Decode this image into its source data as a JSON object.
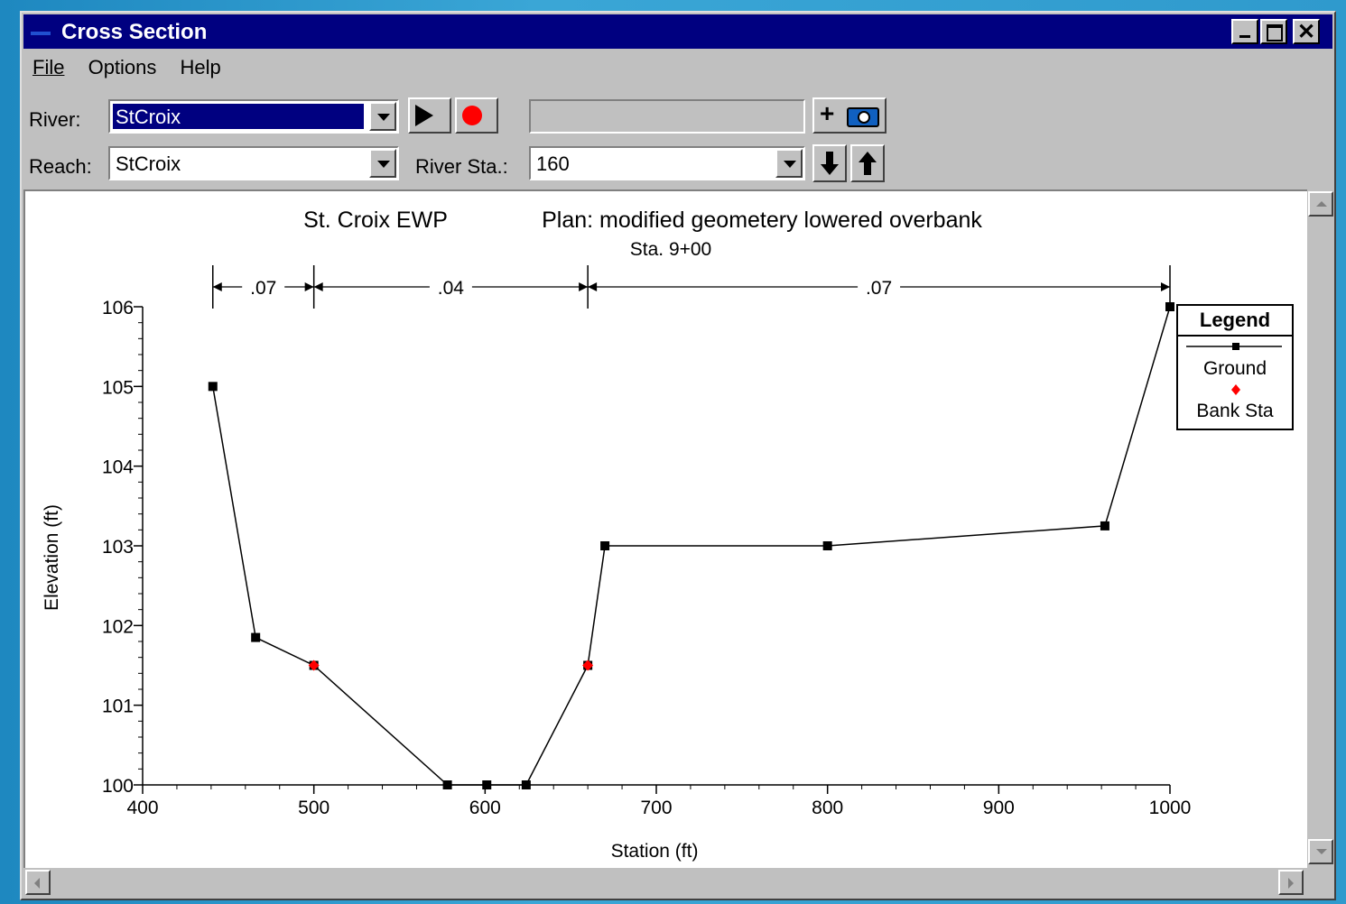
{
  "window": {
    "title": "Cross Section"
  },
  "menu": {
    "file": "File",
    "options": "Options",
    "help": "Help"
  },
  "toolbar": {
    "river_label": "River:",
    "river_value": "StCroix",
    "reach_label": "Reach:",
    "reach_value": "StCroix",
    "river_sta_label": "River Sta.:",
    "river_sta_value": "160",
    "profile_field_value": ""
  },
  "chart_data": {
    "type": "line",
    "title": "St. Croix EWP",
    "plan": "Plan: modified geometery lowered overbank",
    "station_label": "Sta. 9+00",
    "xlabel": "Station (ft)",
    "ylabel": "Elevation (ft)",
    "xlim": [
      400,
      1000
    ],
    "ylim": [
      100,
      106
    ],
    "x_ticks": [
      "400",
      "500",
      "600",
      "700",
      "800",
      "900",
      "1000"
    ],
    "y_ticks": [
      "100",
      "101",
      "102",
      "103",
      "104",
      "105",
      "106"
    ],
    "grid": false,
    "legend": {
      "title": "Legend",
      "placement": "right",
      "entries": [
        "Ground",
        "Bank Sta"
      ]
    },
    "series": [
      {
        "name": "Ground",
        "color": "#000000",
        "marker": "square",
        "x": [
          441,
          466,
          500,
          578,
          601,
          624,
          660,
          670,
          800,
          962,
          1000
        ],
        "y": [
          105,
          101.85,
          101.5,
          100,
          100,
          100,
          101.5,
          103,
          103,
          103.25,
          106
        ]
      },
      {
        "name": "Bank Sta",
        "color": "#ff0000",
        "marker": "diamond",
        "x": [
          500,
          660
        ],
        "y": [
          101.5,
          101.5
        ]
      }
    ],
    "n_values": [
      {
        "label": ".07",
        "from": 441,
        "to": 500
      },
      {
        "label": ".04",
        "from": 500,
        "to": 660
      },
      {
        "label": ".07",
        "from": 660,
        "to": 1000
      }
    ]
  }
}
